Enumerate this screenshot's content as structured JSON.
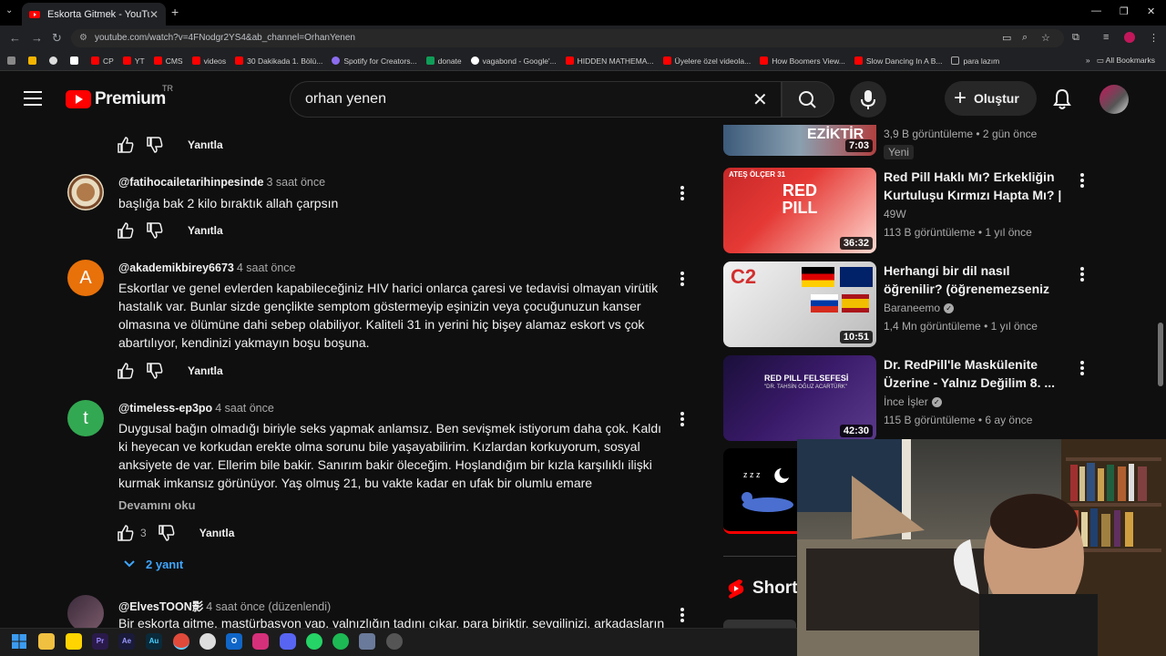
{
  "browser": {
    "tab_title": "Eskorta Gitmek - YouTube",
    "url": "youtube.com/watch?v=4FNodgr2YS4&ab_channel=OrhanYenen",
    "bookmarks": [
      "CP",
      "YT",
      "CMS",
      "videos",
      "30 Dakikada 1. Bölü...",
      "Spotify for Creators...",
      "donate",
      "vagabond - Google'...",
      "HIDDEN MATHEMA...",
      "Üyelere özel videola...",
      "How Boomers View...",
      "Slow Dancing In A B...",
      "para lazım"
    ],
    "all_bookmarks": "All Bookmarks"
  },
  "yt": {
    "logo_word": "Premium",
    "country": "TR",
    "search_value": "orhan yenen",
    "create_label": "Oluştur"
  },
  "comments": {
    "reply_label": "Yanıtla",
    "read_more": "Devamını oku",
    "items": [
      {
        "handle": "@fatihocailetarihinpesinde",
        "time": "3 saat önce",
        "text": "başlığa bak 2 kilo bıraktık allah çarpsın"
      },
      {
        "avatar_letter": "A",
        "handle": "@akademikbirey6673",
        "time": "4 saat önce",
        "text": "Eskortlar ve genel evlerden kapabileceğiniz HIV harici onlarca çaresi ve tedavisi olmayan virütik hastalık var. Bunlar sizde gençlikte semptom göstermeyip eşinizin veya çocuğunuzun kanser olmasına ve ölümüne dahi sebep olabiliyor. Kaliteli 31 in yerini hiç bişey alamaz eskort vs çok abartılıyor, kendinizi yakmayın boşu boşuna."
      },
      {
        "avatar_letter": "t",
        "handle": "@timeless-ep3po",
        "time": "4 saat önce",
        "text": "Duygusal bağın olmadığı biriyle seks yapmak anlamsız. Ben sevişmek istiyorum daha çok. Kaldı ki heyecan ve korkudan erekte olma sorunu bile yaşayabilirim. Kızlardan korkuyorum, sosyal anksiyete de var. Ellerim bile bakir. Sanırım bakir öleceğim. Hoşlandığım bir kızla karşılıklı ilişki kurmak imkansız görünüyor. Yaş olmuş 21, bu vakte kadar en ufak bir olumlu emare göremedim…",
        "likes": "3",
        "replies": "2 yanıt"
      },
      {
        "handle": "@ElvesTOON影",
        "time": "4 saat önce (düzenlendi)",
        "text": "Bir eskorta gitme, mastürbasyon yap, yalnızlığın tadını çıkar, para biriktir, sevgilinizi, arkadaşlarını"
      }
    ]
  },
  "sidebar": {
    "top_video": {
      "duration": "7:03",
      "thumb_text": "EZİKTİR",
      "meta": "3,9 B görüntüleme • 2 gün önce",
      "badge": "Yeni"
    },
    "videos": [
      {
        "thumb_text_top": "ATEŞ ÖLÇER 31",
        "thumb_text_main": "RED PILL",
        "title": "Red Pill Haklı Mı? Erkekliğin Kurtuluşu Kırmızı Hapta Mı? | ...",
        "channel": "49W",
        "meta": "113 B görüntüleme • 1 yıl önce",
        "duration": "36:32"
      },
      {
        "thumb_text_main": "C2",
        "title": "Herhangi bir dil nasıl öğrenilir? (öğrenemezseniz yüzüme ...",
        "channel": "Baraneemo",
        "meta": "1,4 Mn görüntüleme • 1 yıl önce",
        "duration": "10:51"
      },
      {
        "thumb_text_main": "RED PILL FELSEFESİ",
        "thumb_text_sub": "\"DR. TAHSİN OĞUZ ACARTÜRK\"",
        "title": "Dr. RedPill'le Maskülenite Üzerine - Yalnız Değilim 8. ...",
        "channel": "İnce İşler",
        "meta": "115 B görüntüleme • 6 ay önce",
        "duration": "42:30"
      }
    ],
    "shorts_label": "Short"
  },
  "colors": {
    "bg": "#0f0f0f",
    "accent_red": "#ff0000",
    "link_blue": "#3ea6ff"
  }
}
